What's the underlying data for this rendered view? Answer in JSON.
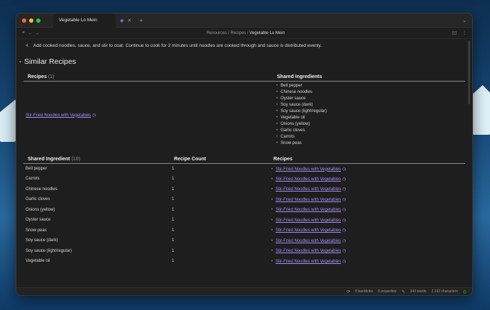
{
  "colors": {
    "accent": "#a58cf5",
    "bg": "#1e1e1e",
    "desktop": "#174a78"
  },
  "titlebar": {
    "tab_title": "Vegetable Lo Mein",
    "tab_icon": "obsidian-icon",
    "close_glyph": "✕",
    "new_tab_glyph": "+",
    "dropdown_glyph": "⌄"
  },
  "navbar": {
    "back_glyph": "←",
    "forward_glyph": "→",
    "sidebar_glyph": "⫷",
    "breadcrumb": {
      "part1": "Resources",
      "sep": "/",
      "part2": "Recipes",
      "current": "Vegetable Lo Mein"
    },
    "reading_glyph": "▯▯",
    "more_glyph": "⋮"
  },
  "content": {
    "step_number": "4.",
    "step_text": "Add cooked noodles, sauce, and stir to coat. Continue to cook for 2 minutes until noodles are cooked through and sauce is distributed evenly.",
    "section_heading": "Similar Recipes",
    "recipes_table": {
      "col1": "Recipes",
      "col1_count": "(1)",
      "col2": "Shared Ingredients",
      "recipe_link": "Stir-Fried Noodles with Vegetables",
      "ingredients": [
        "Bell pepper",
        "Chinese noodles",
        "Oyster sauce",
        "Soy sauce (dark)",
        "Soy sauce (light/regular)",
        "Vegetable oil",
        "Onions (yellow)",
        "Garlic cloves",
        "Carrots",
        "Snow peas"
      ]
    },
    "ingredients_table": {
      "col1": "Shared Ingredient",
      "col1_count": "(10)",
      "col2": "Recipe Count",
      "col3": "Recipes",
      "rows": [
        {
          "name": "Bell pepper",
          "count": "1",
          "recipe": "Stir-Fried Noodles with Vegetables"
        },
        {
          "name": "Carrots",
          "count": "1",
          "recipe": "Stir-Fried Noodles with Vegetables"
        },
        {
          "name": "Chinese noodles",
          "count": "1",
          "recipe": "Stir-Fried Noodles with Vegetables"
        },
        {
          "name": "Garlic cloves",
          "count": "1",
          "recipe": "Stir-Fried Noodles with Vegetables"
        },
        {
          "name": "Onions (yellow)",
          "count": "1",
          "recipe": "Stir-Fried Noodles with Vegetables"
        },
        {
          "name": "Oyster sauce",
          "count": "1",
          "recipe": "Stir-Fried Noodles with Vegetables"
        },
        {
          "name": "Snow peas",
          "count": "1",
          "recipe": "Stir-Fried Noodles with Vegetables"
        },
        {
          "name": "Soy sauce (dark)",
          "count": "1",
          "recipe": "Stir-Fried Noodles with Vegetables"
        },
        {
          "name": "Soy sauce (light/regular)",
          "count": "1",
          "recipe": "Stir-Fried Noodles with Vegetables"
        },
        {
          "name": "Vegetable oil",
          "count": "1",
          "recipe": "Stir-Fried Noodles with Vegetables"
        }
      ]
    }
  },
  "statusbar": {
    "backlinks": "0 backlinks",
    "properties": "6 properties",
    "words": "343 words",
    "characters": "2,162 characters"
  }
}
